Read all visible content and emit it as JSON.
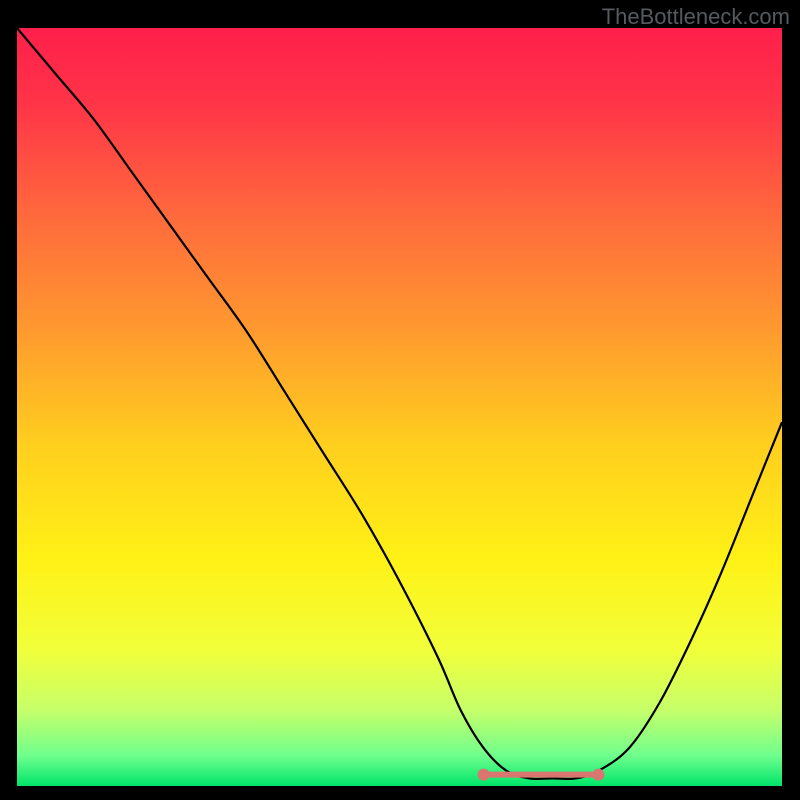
{
  "watermark": "TheBottleneck.com",
  "gradient": {
    "stops": [
      {
        "pos": 0.0,
        "color": "#ff1f4b"
      },
      {
        "pos": 0.1,
        "color": "#ff3448"
      },
      {
        "pos": 0.25,
        "color": "#ff6a3c"
      },
      {
        "pos": 0.4,
        "color": "#ff9a2f"
      },
      {
        "pos": 0.55,
        "color": "#ffcf1e"
      },
      {
        "pos": 0.7,
        "color": "#fff116"
      },
      {
        "pos": 0.82,
        "color": "#f1ff3a"
      },
      {
        "pos": 0.9,
        "color": "#c6ff6a"
      },
      {
        "pos": 0.96,
        "color": "#6fff8d"
      },
      {
        "pos": 1.0,
        "color": "#00e56b"
      }
    ]
  },
  "chart_data": {
    "type": "line",
    "title": "",
    "xlabel": "",
    "ylabel": "",
    "xlim": [
      0,
      100
    ],
    "ylim": [
      0,
      100
    ],
    "x": [
      0,
      5,
      10,
      15,
      20,
      25,
      30,
      35,
      40,
      45,
      50,
      55,
      58,
      61,
      64,
      67,
      70,
      73,
      76,
      80,
      84,
      88,
      92,
      96,
      100
    ],
    "values": [
      100,
      94,
      88,
      81,
      74,
      67,
      60,
      52,
      44,
      36,
      27,
      17,
      10,
      5,
      2,
      1,
      1,
      1,
      2,
      5,
      11,
      19,
      28,
      38,
      48
    ],
    "flat_segment": {
      "x_start": 61,
      "x_end": 76,
      "y": 1.5,
      "color": "#d9766f",
      "marker_radius": 4
    }
  }
}
